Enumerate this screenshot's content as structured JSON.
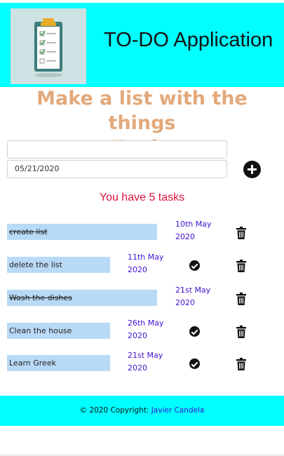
{
  "header": {
    "title": "TO-DO Application",
    "logo_icon": "clipboard-checklist-icon",
    "background": "#00ffff"
  },
  "headline": {
    "line1": "Make a list with the things",
    "line2": "To-do",
    "color": "#e3a97b"
  },
  "form": {
    "task_input": {
      "value": "",
      "placeholder": ""
    },
    "date_input": {
      "value": "05/21/2020"
    },
    "add_icon": "plus-circle-icon"
  },
  "counter": {
    "text": "You have 5 tasks",
    "color": "#dc143c"
  },
  "tasks": [
    {
      "label": "create list",
      "date_line1": "10th May",
      "date_line2": "2020",
      "done": true,
      "actions": [
        "trash-icon"
      ]
    },
    {
      "label": "delete the list",
      "date_line1": "11th May",
      "date_line2": "2020",
      "done": false,
      "actions": [
        "check-icon",
        "trash-icon"
      ]
    },
    {
      "label": "Wash the dishes",
      "date_line1": "21st May",
      "date_line2": "2020",
      "done": true,
      "actions": [
        "trash-icon"
      ]
    },
    {
      "label": "Clean the house",
      "date_line1": "26th May",
      "date_line2": "2020",
      "done": false,
      "actions": [
        "check-icon",
        "trash-icon"
      ]
    },
    {
      "label": "Learn Greek",
      "date_line1": "21st May",
      "date_line2": "2020",
      "done": false,
      "actions": [
        "check-icon",
        "trash-icon"
      ]
    }
  ],
  "footer": {
    "copyright": "© 2020 Copyright:",
    "author_link": "Javier Candela",
    "background": "#00ffff"
  }
}
